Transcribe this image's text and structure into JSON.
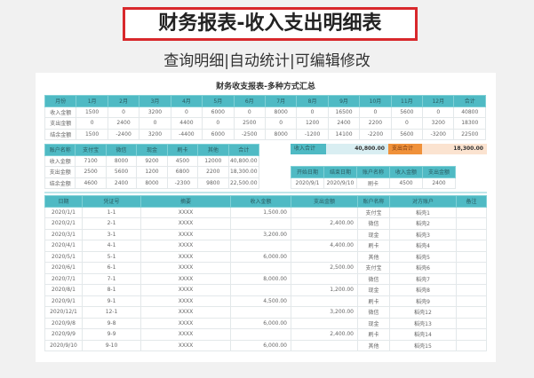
{
  "banner": {
    "title": "财务报表-收入支出明细表",
    "subtitle": "查询明细|自动统计|可编辑修改"
  },
  "report_title": "财务收支报表-多种方式汇总",
  "monthly": {
    "headers": [
      "月份",
      "1月",
      "2月",
      "3月",
      "4月",
      "5月",
      "6月",
      "7月",
      "8月",
      "9月",
      "10月",
      "11月",
      "12月",
      "合计"
    ],
    "rows": [
      [
        "收入金额",
        "1500",
        "0",
        "3200",
        "0",
        "6000",
        "0",
        "8000",
        "0",
        "16500",
        "0",
        "5600",
        "0",
        "40800"
      ],
      [
        "支出金额",
        "0",
        "2400",
        "0",
        "4400",
        "0",
        "2500",
        "0",
        "1200",
        "2400",
        "2200",
        "0",
        "3200",
        "18300"
      ],
      [
        "结余金额",
        "1500",
        "-2400",
        "3200",
        "-4400",
        "6000",
        "-2500",
        "8000",
        "-1200",
        "14100",
        "-2200",
        "5600",
        "-3200",
        "22500"
      ]
    ]
  },
  "accounts": {
    "headers": [
      "账户名称",
      "支付宝",
      "微信",
      "现金",
      "刷卡",
      "其他",
      "合计"
    ],
    "rows": [
      [
        "收入金额",
        "7100",
        "8000",
        "9200",
        "4500",
        "12000",
        "40,800.00"
      ],
      [
        "支出金额",
        "2500",
        "5600",
        "1200",
        "6800",
        "2200",
        "18,300.00"
      ],
      [
        "结余金额",
        "4600",
        "2400",
        "8000",
        "-2300",
        "9800",
        "22,500.00"
      ]
    ]
  },
  "totals": {
    "income_label": "收入合计",
    "income_value": "40,800.00",
    "expense_label": "支出合计",
    "expense_value": "18,300.00",
    "income_color": "#d9eef2",
    "expense_color": "#f0913a"
  },
  "query": {
    "headers": [
      "开始日期",
      "结束日期",
      "账户名称",
      "收入金额",
      "支出金额"
    ],
    "row": [
      "2020/9/1",
      "2020/9/10",
      "刷卡",
      "4500",
      "2400"
    ]
  },
  "detail": {
    "headers": [
      "日期",
      "凭证号",
      "摘要",
      "收入金额",
      "支出金额",
      "账户名称",
      "对方账户",
      "备注"
    ],
    "rows": [
      [
        "2020/1/1",
        "1-1",
        "XXXX",
        "1,500.00",
        "",
        "支付宝",
        "稻壳1",
        ""
      ],
      [
        "2020/2/1",
        "2-1",
        "XXXX",
        "",
        "2,400.00",
        "微信",
        "稻壳2",
        ""
      ],
      [
        "2020/3/1",
        "3-1",
        "XXXX",
        "3,200.00",
        "",
        "现金",
        "稻壳3",
        ""
      ],
      [
        "2020/4/1",
        "4-1",
        "XXXX",
        "",
        "4,400.00",
        "刷卡",
        "稻壳4",
        ""
      ],
      [
        "2020/5/1",
        "5-1",
        "XXXX",
        "6,000.00",
        "",
        "其他",
        "稻壳5",
        ""
      ],
      [
        "2020/6/1",
        "6-1",
        "XXXX",
        "",
        "2,500.00",
        "支付宝",
        "稻壳6",
        ""
      ],
      [
        "2020/7/1",
        "7-1",
        "XXXX",
        "8,000.00",
        "",
        "微信",
        "稻壳7",
        ""
      ],
      [
        "2020/8/1",
        "8-1",
        "XXXX",
        "",
        "1,200.00",
        "现金",
        "稻壳8",
        ""
      ],
      [
        "2020/9/1",
        "9-1",
        "XXXX",
        "4,500.00",
        "",
        "刷卡",
        "稻壳9",
        ""
      ],
      [
        "2020/12/1",
        "12-1",
        "XXXX",
        "",
        "3,200.00",
        "微信",
        "稻壳12",
        ""
      ],
      [
        "2020/9/8",
        "9-8",
        "XXXX",
        "6,000.00",
        "",
        "现金",
        "稻壳13",
        ""
      ],
      [
        "2020/9/9",
        "9-9",
        "XXXX",
        "",
        "2,400.00",
        "刷卡",
        "稻壳14",
        ""
      ],
      [
        "2020/9/10",
        "9-10",
        "XXXX",
        "6,000.00",
        "",
        "其他",
        "稻壳15",
        ""
      ]
    ]
  }
}
